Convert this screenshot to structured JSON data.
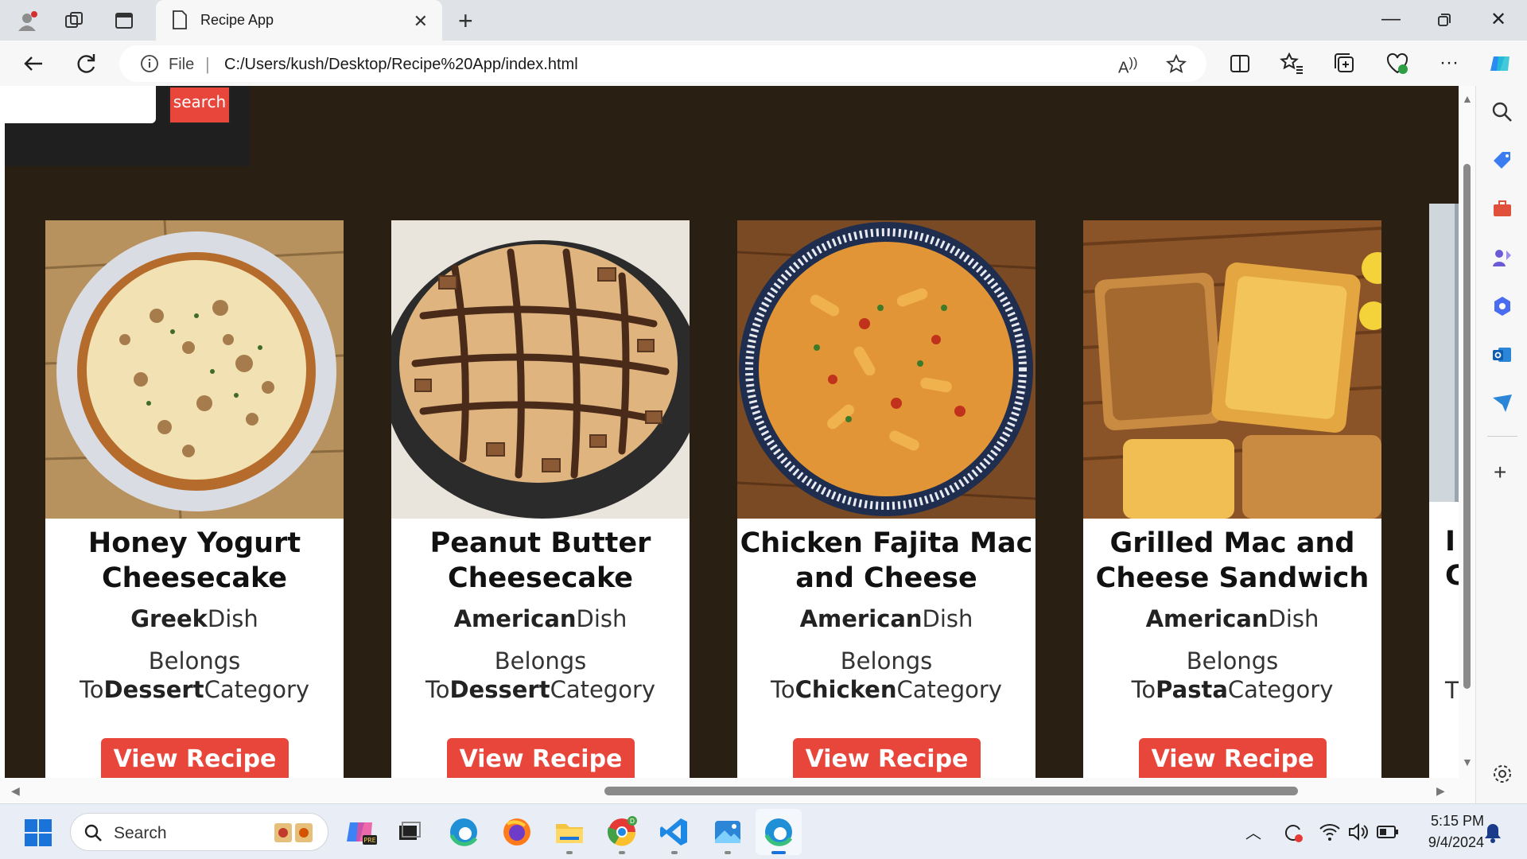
{
  "browser": {
    "tab_title": "Recipe App",
    "address_scheme": "File",
    "address_url": "C:/Users/kush/Desktop/Recipe%20App/index.html"
  },
  "page": {
    "search_placeholder": "",
    "search_button_label": "search",
    "view_button_label": "View Recipe",
    "area_suffix": "Dish",
    "category_prefix": "Belongs To",
    "category_suffix": "Category",
    "accent_color": "#e8453b",
    "background_color": "#2a1f13",
    "cards": [
      {
        "title": "Honey Yogurt Cheesecake",
        "area": "Greek",
        "category": "Dessert"
      },
      {
        "title": "Peanut Butter Cheesecake",
        "area": "American",
        "category": "Dessert"
      },
      {
        "title": "Chicken Fajita Mac and Cheese",
        "area": "American",
        "category": "Chicken"
      },
      {
        "title": "Grilled Mac and Cheese Sandwich",
        "area": "American",
        "category": "Pasta"
      }
    ],
    "partial_card": {
      "title_start_1": "I",
      "title_start_2": "C",
      "category_start": "T"
    }
  },
  "taskbar": {
    "search_label": "Search",
    "time": "5:15 PM",
    "date": "9/4/2024"
  }
}
